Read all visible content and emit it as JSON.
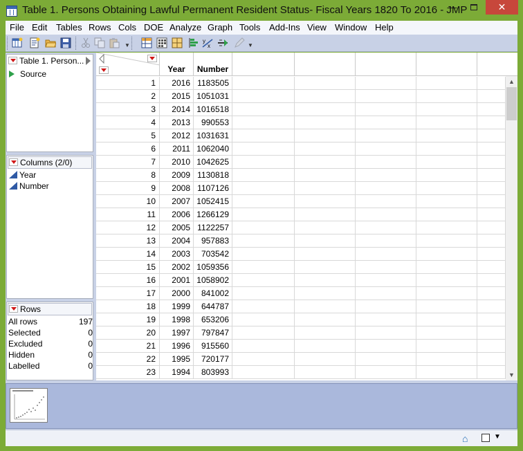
{
  "window": {
    "title": "Table 1. Persons Obtaining Lawful Permanent Resident Status- Fiscal Years 1820 To 2016 - JMP",
    "minimize": "—",
    "close": "✕"
  },
  "menu": [
    "File",
    "Edit",
    "Tables",
    "Rows",
    "Cols",
    "DOE",
    "Analyze",
    "Graph",
    "Tools",
    "Add-Ins",
    "View",
    "Window",
    "Help"
  ],
  "table_panel": {
    "title": "Table 1. Person...",
    "source_label": "Source"
  },
  "columns_panel": {
    "title": "Columns (2/0)",
    "items": [
      "Year",
      "Number"
    ]
  },
  "rows_panel": {
    "title": "Rows",
    "stats": [
      {
        "label": "All rows",
        "value": "197"
      },
      {
        "label": "Selected",
        "value": "0"
      },
      {
        "label": "Excluded",
        "value": "0"
      },
      {
        "label": "Hidden",
        "value": "0"
      },
      {
        "label": "Labelled",
        "value": "0"
      }
    ]
  },
  "table": {
    "headers": [
      "Year",
      "Number"
    ],
    "rows": [
      {
        "n": "1",
        "year": "2016",
        "number": "1183505"
      },
      {
        "n": "2",
        "year": "2015",
        "number": "1051031"
      },
      {
        "n": "3",
        "year": "2014",
        "number": "1016518"
      },
      {
        "n": "4",
        "year": "2013",
        "number": "990553"
      },
      {
        "n": "5",
        "year": "2012",
        "number": "1031631"
      },
      {
        "n": "6",
        "year": "2011",
        "number": "1062040"
      },
      {
        "n": "7",
        "year": "2010",
        "number": "1042625"
      },
      {
        "n": "8",
        "year": "2009",
        "number": "1130818"
      },
      {
        "n": "9",
        "year": "2008",
        "number": "1107126"
      },
      {
        "n": "10",
        "year": "2007",
        "number": "1052415"
      },
      {
        "n": "11",
        "year": "2006",
        "number": "1266129"
      },
      {
        "n": "12",
        "year": "2005",
        "number": "1122257"
      },
      {
        "n": "13",
        "year": "2004",
        "number": "957883"
      },
      {
        "n": "14",
        "year": "2003",
        "number": "703542"
      },
      {
        "n": "15",
        "year": "2002",
        "number": "1059356"
      },
      {
        "n": "16",
        "year": "2001",
        "number": "1058902"
      },
      {
        "n": "17",
        "year": "2000",
        "number": "841002"
      },
      {
        "n": "18",
        "year": "1999",
        "number": "644787"
      },
      {
        "n": "19",
        "year": "1998",
        "number": "653206"
      },
      {
        "n": "20",
        "year": "1997",
        "number": "797847"
      },
      {
        "n": "21",
        "year": "1996",
        "number": "915560"
      },
      {
        "n": "22",
        "year": "1995",
        "number": "720177"
      },
      {
        "n": "23",
        "year": "1994",
        "number": "803993"
      }
    ]
  },
  "icons": {
    "toolbar": [
      "new-data-table-icon",
      "new-script-icon",
      "open-icon",
      "save-icon",
      "cut-icon",
      "copy-icon",
      "paste-icon",
      "data-table-icon",
      "data-grid-icon",
      "layout-icon",
      "distribution-icon",
      "fit-y-by-x-icon",
      "fit-model-icon",
      "edit-icon"
    ],
    "status": [
      "home-icon",
      "window-box-icon",
      "dropdown-icon"
    ]
  },
  "colors": {
    "window_frame": "#7cab37",
    "close_button": "#c7473b",
    "toolbar_bg": "#c8d1e6",
    "thumbnail_bar": "#aab8dc",
    "disclosure_red": "#d01818",
    "continuous_blue": "#2f5aa5"
  }
}
